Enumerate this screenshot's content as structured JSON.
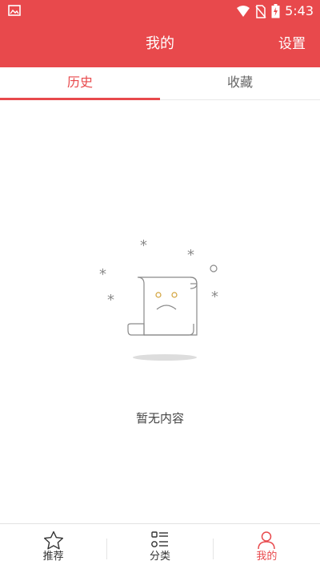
{
  "status_bar": {
    "time": "5:43",
    "icons": [
      "image-icon",
      "wifi-icon",
      "no-sim-icon",
      "battery-charging-icon"
    ]
  },
  "header": {
    "title": "我的",
    "settings_label": "设置"
  },
  "tabs": [
    {
      "label": "历史",
      "active": true
    },
    {
      "label": "收藏",
      "active": false
    }
  ],
  "empty_state": {
    "icon": "sad-scroll-icon",
    "text": "暂无内容"
  },
  "bottom_nav": [
    {
      "label": "推荐",
      "icon": "star-icon",
      "active": false
    },
    {
      "label": "分类",
      "icon": "category-list-icon",
      "active": false
    },
    {
      "label": "我的",
      "icon": "user-icon",
      "active": true
    }
  ],
  "colors": {
    "accent": "#e8494c",
    "text": "#333333",
    "muted": "#666666"
  }
}
